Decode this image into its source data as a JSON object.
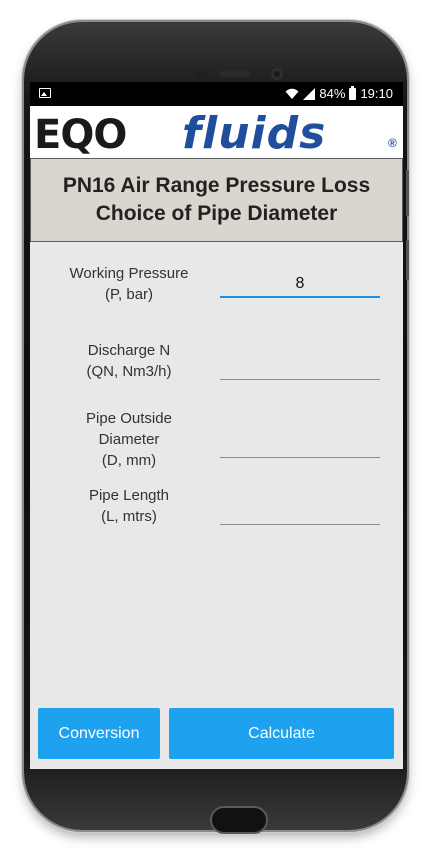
{
  "status_bar": {
    "battery": "84%",
    "time": "19:10",
    "icons": [
      "image-icon",
      "wifi-icon",
      "signal-icon",
      "battery-icon"
    ]
  },
  "logo": {
    "eqo": "EQO",
    "fluids": "fluids",
    "reg": "®"
  },
  "title": {
    "line1": "PN16 Air Range Pressure Loss",
    "line2": "Choice of Pipe Diameter"
  },
  "fields": [
    {
      "label_line1": "Working Pressure",
      "label_line2": "(P, bar)",
      "value": "8"
    },
    {
      "label_line1": "Discharge N",
      "label_line2": "(QN, Nm3/h)",
      "value": ""
    },
    {
      "label_line1": "Pipe Outside",
      "label_line2": "Diameter",
      "label_line3": "(D, mm)",
      "value": ""
    },
    {
      "label_line1": "Pipe Length",
      "label_line2": "(L, mtrs)",
      "value": ""
    }
  ],
  "buttons": {
    "conversion": "Conversion",
    "calculate": "Calculate"
  },
  "colors": {
    "accent": "#1ea1ee",
    "brand": "#1f4f9c",
    "title_bg": "#dad5cd",
    "screen_bg": "#e8e8e8"
  }
}
